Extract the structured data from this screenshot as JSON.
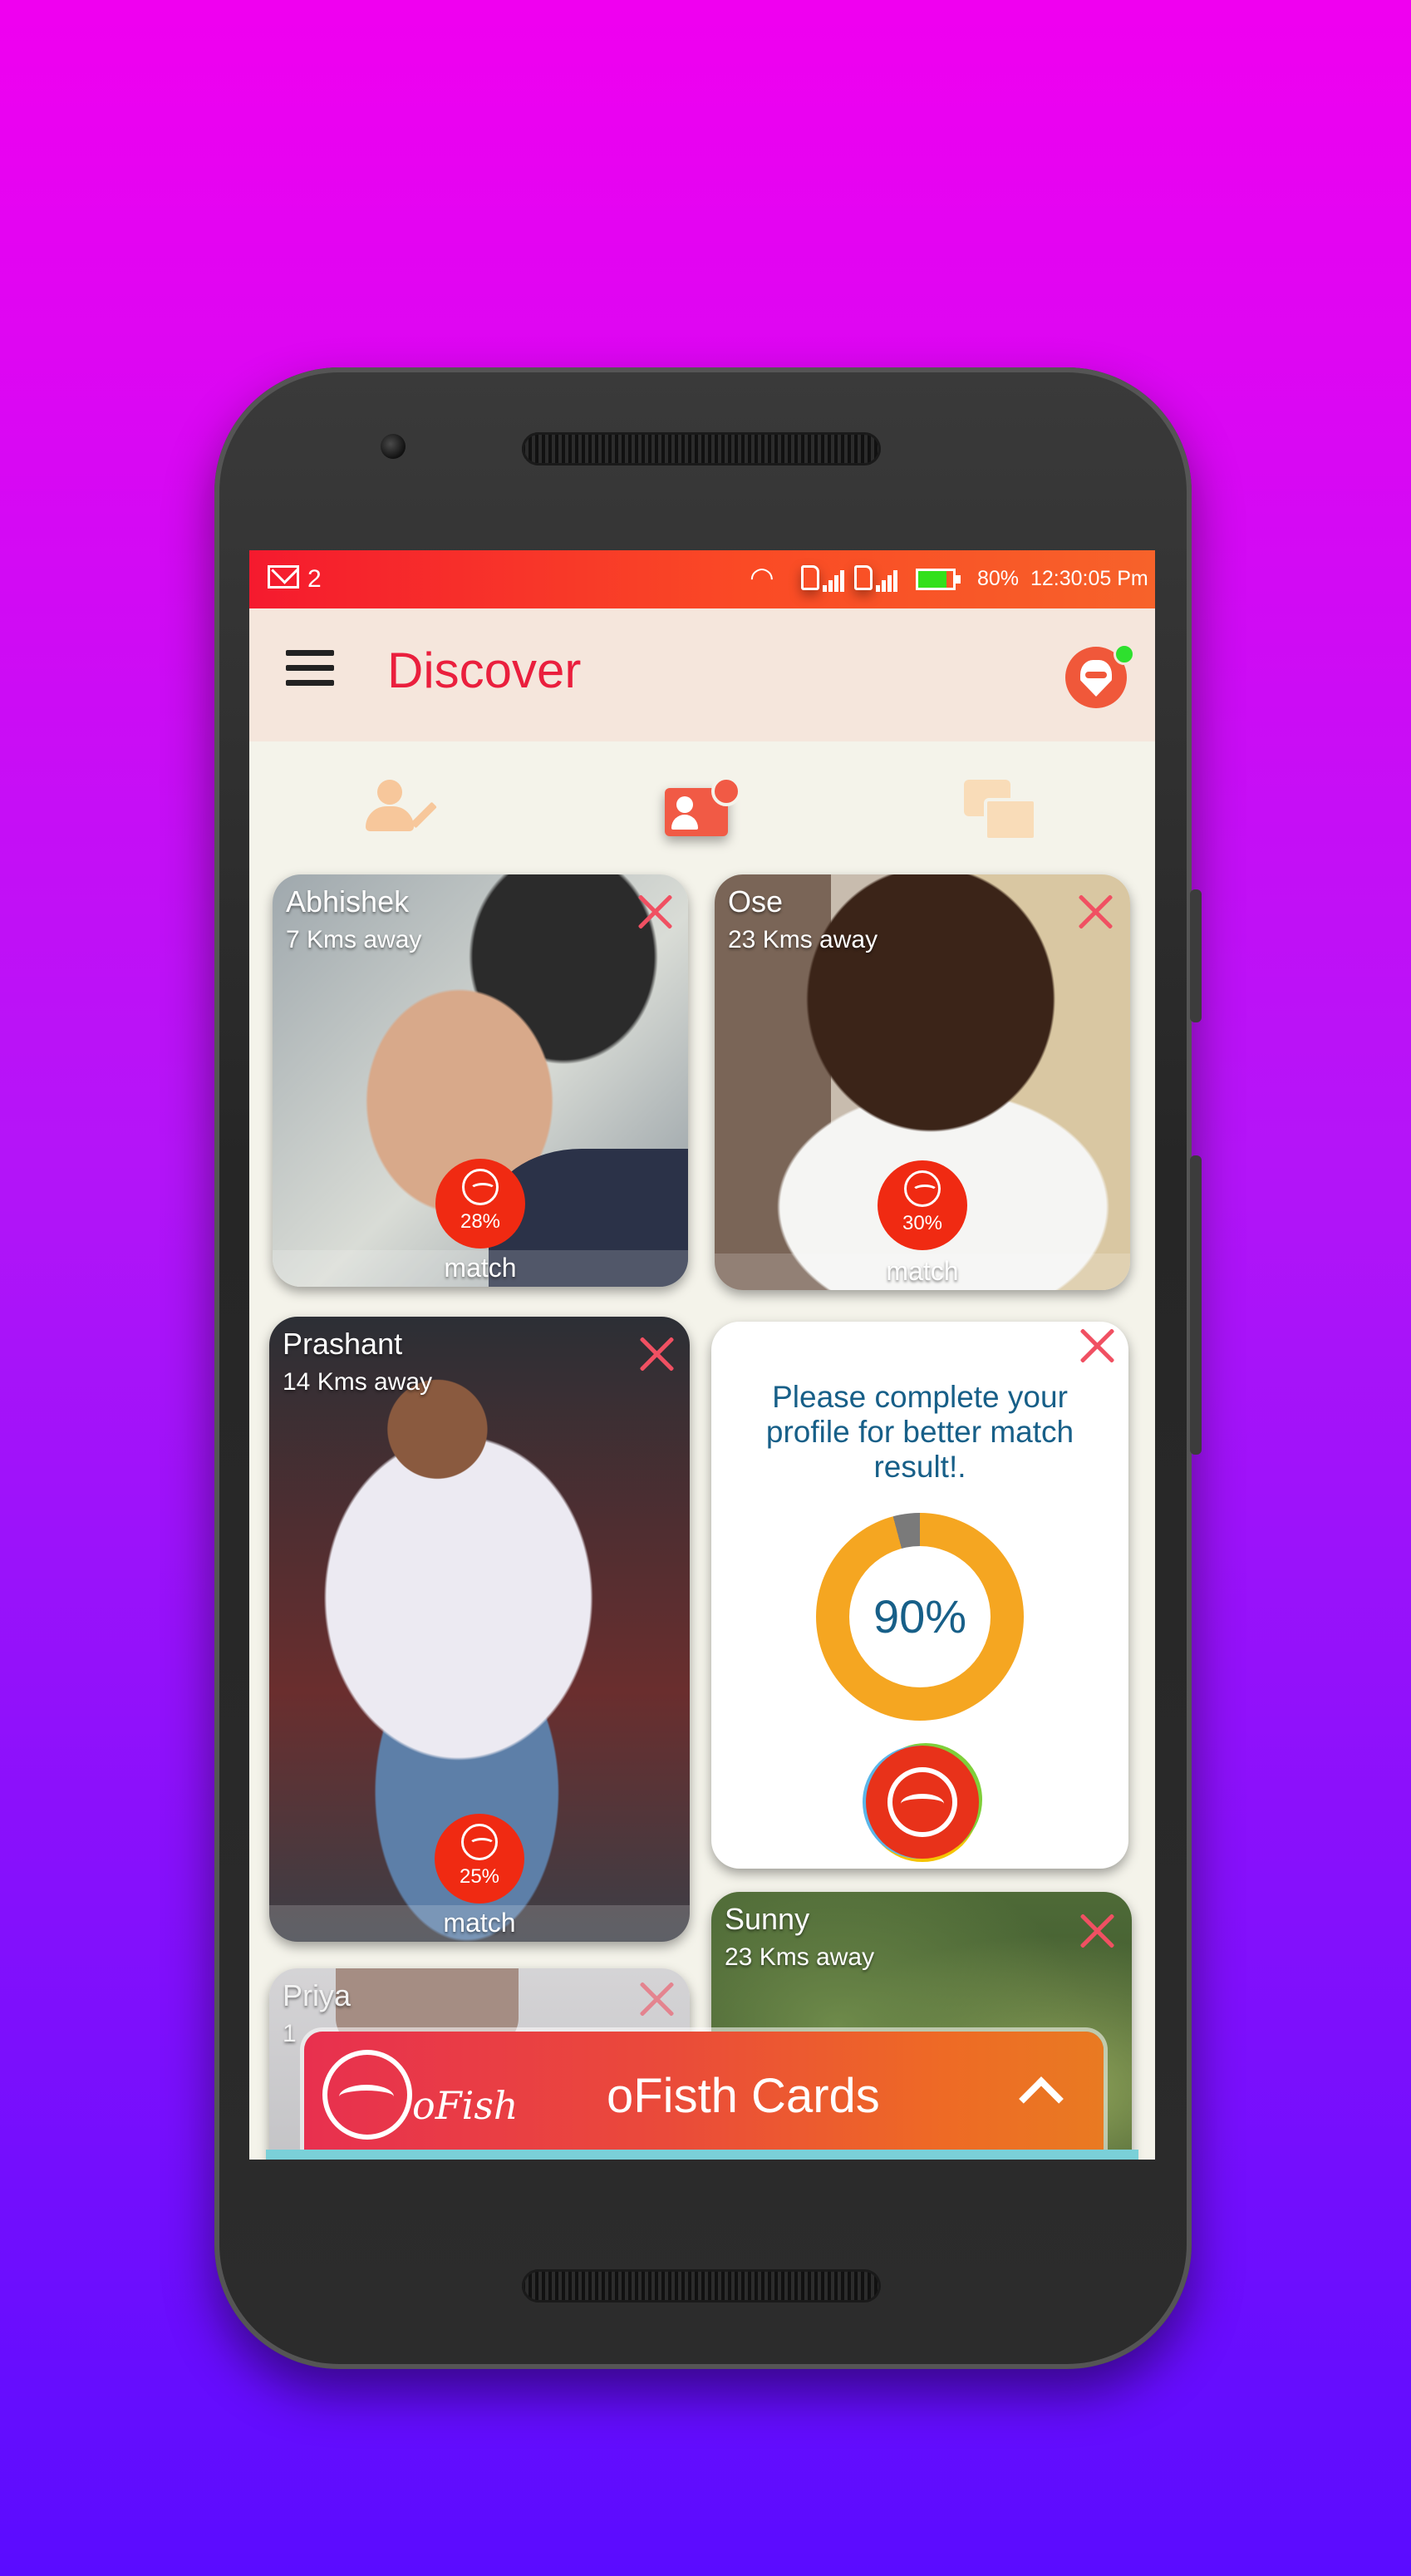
{
  "status_bar": {
    "mail_count": "2",
    "battery_percent": "80%",
    "battery_level": 0.8,
    "time": "12:30:05 Pm"
  },
  "app_bar": {
    "title": "Discover"
  },
  "tabs": [
    {
      "icon": "edit-profile-icon"
    },
    {
      "icon": "discover-settings-icon"
    },
    {
      "icon": "chat-icon"
    }
  ],
  "cards": [
    {
      "name": "Abhishek",
      "distance": "7 Kms away",
      "match_percent": "28%",
      "match_label": "match"
    },
    {
      "name": "Ose",
      "distance": "23 Kms away",
      "match_percent": "30%",
      "match_label": "match"
    },
    {
      "name": "Prashant",
      "distance": "14 Kms away",
      "match_percent": "25%",
      "match_label": "match"
    },
    {
      "name": "Sunny",
      "distance": "23 Kms away"
    },
    {
      "name": "Priya",
      "distance": "1"
    }
  ],
  "profile_prompt": {
    "message": "Please complete your profile for better match result!.",
    "completion": "90%",
    "completion_value": 0.9
  },
  "banner": {
    "brand": "oFish",
    "title": "oFisth Cards"
  },
  "colors": {
    "accent": "#ea1f3d",
    "status_bar": "#f7622a",
    "badge": "#f02a12",
    "donut": "#f5a621",
    "prompt_text": "#175f88"
  }
}
